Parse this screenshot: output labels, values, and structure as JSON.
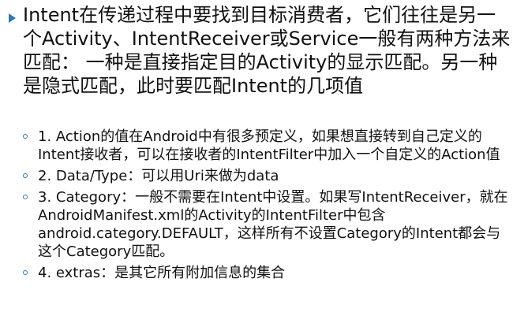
{
  "main_paragraph": "Intent在传递过程中要找到目标消费者，它们往往是另一个Activity、IntentReceiver或Service一般有两种方法来匹配： 一种是直接指定目的Activity的显示匹配。另一种是隐式匹配，此时要匹配Intent的几项值",
  "sub_items": [
    "1. Action的值在Android中有很多预定义，如果想直接转到自己定义的Intent接收者，可以在接收者的IntentFilter中加入一个自定义的Action值",
    "2. Data/Type：可以用Uri来做为data",
    "3. Category：一般不需要在Intent中设置。如果写IntentReceiver，就在AndroidManifest.xml的Activity的IntentFilter中包含android.category.DEFAULT，这样所有不设置Category的Intent都会与这个Category匹配。",
    "4. extras：是其它所有附加信息的集合"
  ],
  "colors": {
    "background": "#ffffff",
    "text": "#111111",
    "bullet": "#2f78bd",
    "spellcheck_underline": "#d13b3b"
  },
  "icons": {
    "main_bullet": "triangle-bullet-icon",
    "sub_bullet": "circle-bullet-icon"
  }
}
